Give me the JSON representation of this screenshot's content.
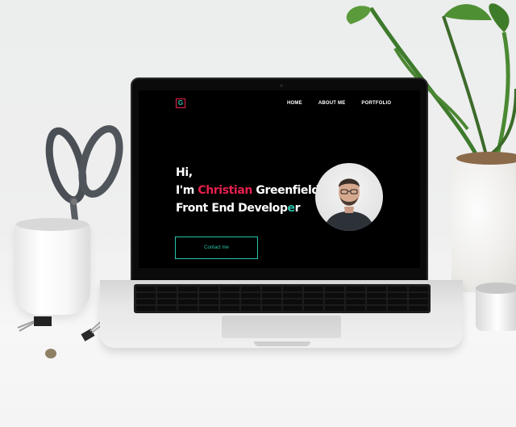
{
  "site": {
    "logo_letter": "G",
    "nav": [
      "HOME",
      "ABOUT ME",
      "PORTFOLIO"
    ],
    "hero": {
      "line1": "Hi,",
      "line2_prefix": "I'm ",
      "line2_first_name": "Christian",
      "line2_last_name": " Greenfield,",
      "line3_main": "Front End Develop",
      "line3_accent": "e",
      "line3_end": "r"
    },
    "contact_button": "Contact me"
  },
  "colors": {
    "accent": "#e8204d",
    "teal": "#29c4a9",
    "background": "#000000"
  },
  "icons": [
    "logo-icon",
    "avatar-photo"
  ]
}
